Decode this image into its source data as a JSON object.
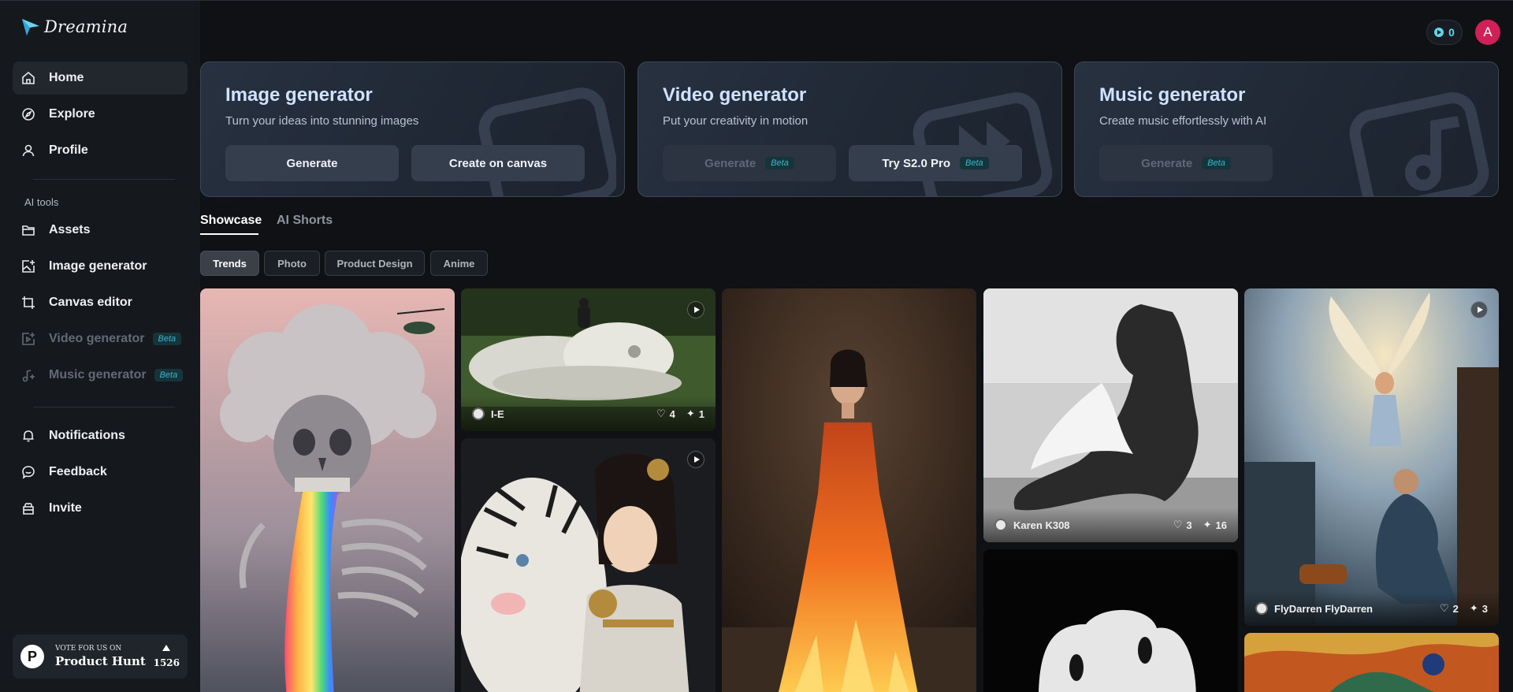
{
  "app": {
    "name": "Dreamina"
  },
  "sidebar": {
    "items": [
      {
        "label": "Home",
        "icon": "home-icon"
      },
      {
        "label": "Explore",
        "icon": "compass-icon"
      },
      {
        "label": "Profile",
        "icon": "user-icon"
      }
    ],
    "section_label": "AI tools",
    "tools": [
      {
        "label": "Assets",
        "icon": "folder-icon"
      },
      {
        "label": "Image generator",
        "icon": "image-plus-icon"
      },
      {
        "label": "Canvas editor",
        "icon": "crop-icon"
      },
      {
        "label": "Video generator",
        "icon": "video-plus-icon",
        "badge": "Beta"
      },
      {
        "label": "Music generator",
        "icon": "music-plus-icon",
        "badge": "Beta"
      }
    ],
    "bottom": [
      {
        "label": "Notifications",
        "icon": "bell-icon"
      },
      {
        "label": "Feedback",
        "icon": "chat-icon"
      },
      {
        "label": "Invite",
        "icon": "gift-icon"
      }
    ],
    "product_hunt": {
      "small": "VOTE FOR US ON",
      "big": "Product Hunt",
      "votes": "1526",
      "logo": "P"
    }
  },
  "header": {
    "credits": "0",
    "avatar_initial": "A"
  },
  "cards": [
    {
      "title": "Image generator",
      "subtitle": "Turn your ideas into stunning images",
      "btn1": "Generate",
      "btn2": "Create on canvas"
    },
    {
      "title": "Video generator",
      "subtitle": "Put your creativity in motion",
      "btn1": "Generate",
      "btn1_badge": "Beta",
      "btn2": "Try S2.0 Pro",
      "btn2_badge": "Beta"
    },
    {
      "title": "Music generator",
      "subtitle": "Create music effortlessly with AI",
      "btn1": "Generate",
      "btn1_badge": "Beta"
    }
  ],
  "tabs": [
    "Showcase",
    "AI Shorts"
  ],
  "filters": [
    "Trends",
    "Photo",
    "Product Design",
    "Anime"
  ],
  "gallery": {
    "snake": {
      "user": "I-E",
      "likes": "4",
      "remixes": "1"
    },
    "sculpture": {
      "user": "Karen K308",
      "likes": "3",
      "remixes": "16"
    },
    "angel": {
      "user": "FlyDarren FlyDarren",
      "likes": "2",
      "remixes": "3"
    }
  },
  "colors": {
    "accent": "#38b6cc",
    "avatar": "#d11f58",
    "background": "#0f1115"
  }
}
